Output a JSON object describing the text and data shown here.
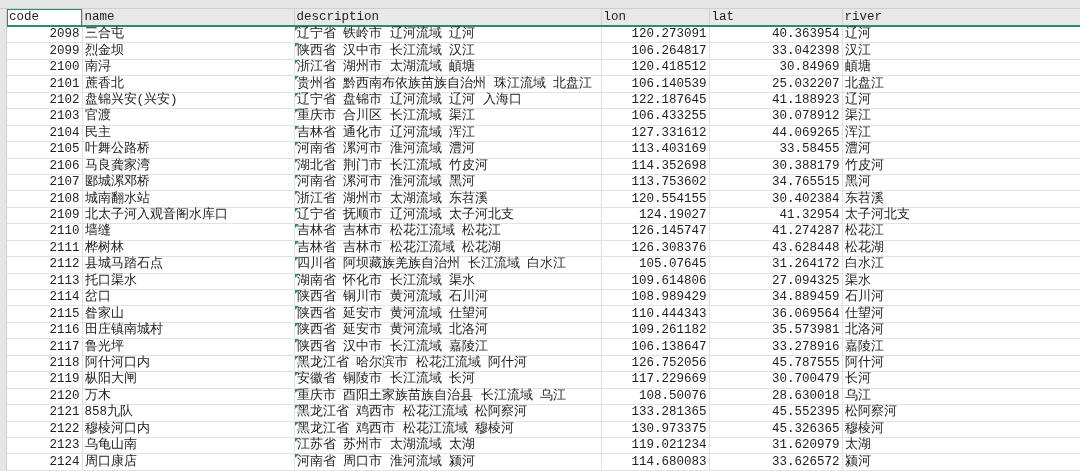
{
  "columns": [
    {
      "label": "code",
      "selected": true
    },
    {
      "label": "name",
      "selected": false
    },
    {
      "label": "description",
      "selected": false
    },
    {
      "label": "lon",
      "selected": false
    },
    {
      "label": "lat",
      "selected": false
    },
    {
      "label": "river",
      "selected": false
    }
  ],
  "rows": [
    [
      "2098",
      "三合屯",
      "辽宁省 铁岭市 辽河流域 辽河",
      "120.273091",
      "40.363954",
      "辽河"
    ],
    [
      "2099",
      "烈金坝",
      "陕西省 汉中市 长江流域 汉江",
      "106.264817",
      "33.042398",
      "汉江"
    ],
    [
      "2100",
      "南浔",
      "浙江省 湖州市 太湖流域 頔塘",
      "120.418512",
      "30.84969",
      "頔塘"
    ],
    [
      "2101",
      "蔗香北",
      "贵州省 黔西南布依族苗族自治州 珠江流域 北盘江",
      "106.140539",
      "25.032207",
      "北盘江"
    ],
    [
      "2102",
      "盘锦兴安(兴安)",
      "辽宁省 盘锦市 辽河流域 辽河 入海口",
      "122.187645",
      "41.188923",
      "辽河"
    ],
    [
      "2103",
      "官渡",
      "重庆市 合川区 长江流域 渠江",
      "106.433255",
      "30.078912",
      "渠江"
    ],
    [
      "2104",
      "民主",
      "吉林省 通化市 辽河流域 浑江",
      "127.331612",
      "44.069265",
      "浑江"
    ],
    [
      "2105",
      "叶舞公路桥",
      "河南省 漯河市 淮河流域 澧河",
      "113.403169",
      "33.58455",
      "澧河"
    ],
    [
      "2106",
      "马良龚家湾",
      "湖北省 荆门市 长江流域 竹皮河",
      "114.352698",
      "30.388179",
      "竹皮河"
    ],
    [
      "2107",
      "郾城漯邓桥",
      "河南省 漯河市 淮河流域 黑河",
      "113.753602",
      "34.765515",
      "黑河"
    ],
    [
      "2108",
      "城南翻水站",
      "浙江省 湖州市 太湖流域 东苕溪",
      "120.554155",
      "30.402384",
      "东苕溪"
    ],
    [
      "2109",
      "北太子河入观音阁水库口",
      "辽宁省 抚顺市 辽河流域 太子河北支",
      "124.19027",
      "41.32954",
      "太子河北支"
    ],
    [
      "2110",
      "墙缝",
      "吉林省 吉林市 松花江流域 松花江",
      "126.145747",
      "41.274287",
      "松花江"
    ],
    [
      "2111",
      "桦树林",
      "吉林省 吉林市 松花江流域 松花湖",
      "126.308376",
      "43.628448",
      "松花湖"
    ],
    [
      "2112",
      "县城马踏石点",
      "四川省 阿坝藏族羌族自治州 长江流域 白水江",
      "105.07645",
      "31.264172",
      "白水江"
    ],
    [
      "2113",
      "托口渠水",
      "湖南省 怀化市 长江流域 渠水",
      "109.614806",
      "27.094325",
      "渠水"
    ],
    [
      "2114",
      "岔口",
      "陕西省 铜川市 黄河流域 石川河",
      "108.989429",
      "34.889459",
      "石川河"
    ],
    [
      "2115",
      "昝家山",
      "陕西省 延安市 黄河流域 仕望河",
      "110.444343",
      "36.069564",
      "仕望河"
    ],
    [
      "2116",
      "田庄镇南城村",
      "陕西省 延安市 黄河流域 北洛河",
      "109.261182",
      "35.573981",
      "北洛河"
    ],
    [
      "2117",
      "鲁光坪",
      "陕西省 汉中市 长江流域 嘉陵江",
      "106.138647",
      "33.278916",
      "嘉陵江"
    ],
    [
      "2118",
      "阿什河口内",
      "黑龙江省 哈尔滨市 松花江流域 阿什河",
      "126.752056",
      "45.787555",
      "阿什河"
    ],
    [
      "2119",
      "枞阳大闸",
      "安徽省 铜陵市 长江流域 长河",
      "117.229669",
      "30.700479",
      "长河"
    ],
    [
      "2120",
      "万木",
      "重庆市 酉阳土家族苗族自治县 长江流域 乌江",
      "108.50076",
      "28.630018",
      "乌江"
    ],
    [
      "2121",
      "858九队",
      "黑龙江省 鸡西市 松花江流域 松阿察河",
      "133.281365",
      "45.552395",
      "松阿察河"
    ],
    [
      "2122",
      "穆棱河口内",
      "黑龙江省 鸡西市 松花江流域 穆棱河",
      "130.973375",
      "45.326365",
      "穆棱河"
    ],
    [
      "2123",
      "乌龟山南",
      "江苏省 苏州市 太湖流域 太湖",
      "119.021234",
      "31.620979",
      "太湖"
    ],
    [
      "2124",
      "周口康店",
      "河南省 周口市 淮河流域 颍河",
      "114.680083",
      "33.626572",
      "颍河"
    ]
  ]
}
